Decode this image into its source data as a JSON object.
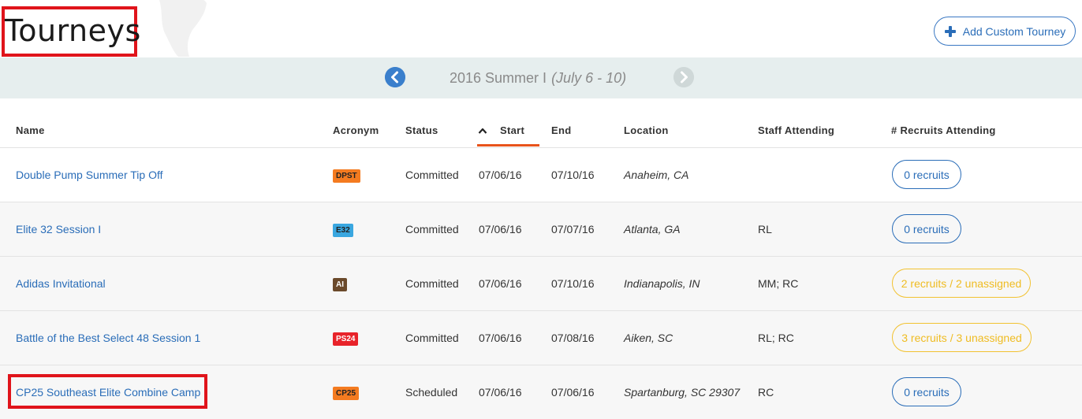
{
  "page": {
    "title": "Tourneys",
    "add_button_label": "Add Custom Tourney"
  },
  "period": {
    "name": "2016 Summer I",
    "dates": "(July 6 - 10)"
  },
  "columns": [
    "Name",
    "Acronym",
    "Status",
    "Start",
    "End",
    "Location",
    "Staff Attending",
    "# Recruits Attending"
  ],
  "sort": {
    "column": "Start",
    "direction": "ascending"
  },
  "rows": [
    {
      "name": "Double Pump Summer Tip Off",
      "acronym": "DPST",
      "acronym_color": "#f47b20",
      "status": "Committed",
      "start": "07/06/16",
      "end": "07/10/16",
      "location": "Anaheim, CA",
      "staff": "",
      "recruits": "0 recruits",
      "recruits_state": "normal"
    },
    {
      "name": "Elite 32 Session I",
      "acronym": "E32",
      "acronym_color": "#3aa7e0",
      "status": "Committed",
      "start": "07/06/16",
      "end": "07/07/16",
      "location": "Atlanta, GA",
      "staff": "RL",
      "recruits": "0 recruits",
      "recruits_state": "normal"
    },
    {
      "name": "Adidas Invitational",
      "acronym": "AI",
      "acronym_color": "#6b4a2b",
      "status": "Committed",
      "start": "07/06/16",
      "end": "07/10/16",
      "location": "Indianapolis, IN",
      "staff": "MM; RC",
      "recruits": "2 recruits / 2 unassigned",
      "recruits_state": "warning"
    },
    {
      "name": "Battle of the Best Select 48 Session 1",
      "acronym": "PS24",
      "acronym_color": "#e8232a",
      "status": "Committed",
      "start": "07/06/16",
      "end": "07/08/16",
      "location": "Aiken, SC",
      "staff": "RL; RC",
      "recruits": "3 recruits / 3 unassigned",
      "recruits_state": "warning"
    },
    {
      "name": "CP25 Southeast Elite Combine Camp",
      "acronym": "CP25",
      "acronym_color": "#f47b20",
      "status": "Scheduled",
      "start": "07/06/16",
      "end": "07/06/16",
      "location": "Spartanburg, SC 29307",
      "staff": "RC",
      "recruits": "0 recruits",
      "recruits_state": "normal"
    }
  ],
  "colors": {
    "accent": "#2a6db8",
    "sort_indicator": "#e8531b",
    "warning": "#f2c231",
    "highlight": "#e0141b"
  }
}
